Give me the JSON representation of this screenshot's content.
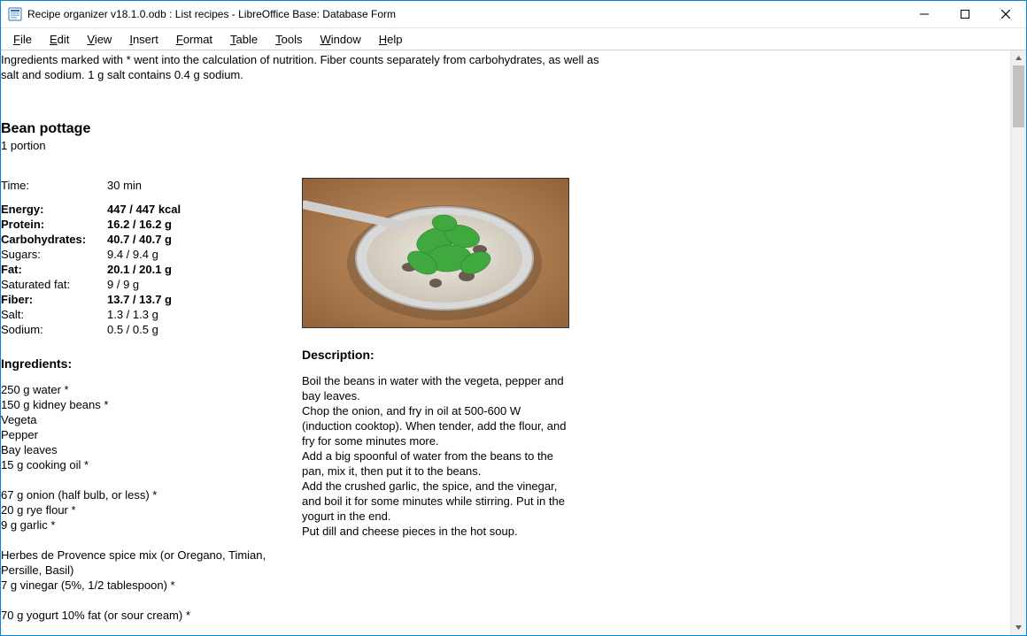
{
  "window": {
    "title": "Recipe organizer v18.1.0.odb : List recipes - LibreOffice Base: Database Form"
  },
  "menu": {
    "file": "File",
    "edit": "Edit",
    "view": "View",
    "insert": "Insert",
    "format": "Format",
    "table": "Table",
    "tools": "Tools",
    "window": "Window",
    "help": "Help"
  },
  "note_line1": "Ingredients marked with * went into the calculation of nutrition. Fiber counts separately from carbohydrates, as well as",
  "note_line2": "salt and sodium. 1 g salt contains 0.4 g sodium.",
  "recipe": {
    "title": "Bean pottage",
    "portion": "1 portion",
    "time_label": "Time:",
    "time_value": "30 min",
    "nutrition": [
      {
        "label": "Energy:",
        "value": "447 / 447 kcal",
        "bold": true
      },
      {
        "label": "Protein:",
        "value": "16.2 / 16.2 g",
        "bold": true
      },
      {
        "label": "Carbohydrates:",
        "value": "40.7 / 40.7 g",
        "bold": true
      },
      {
        "label": "Sugars:",
        "value": "9.4 / 9.4 g",
        "bold": false
      },
      {
        "label": "Fat:",
        "value": "20.1 / 20.1 g",
        "bold": true
      },
      {
        "label": "Saturated fat:",
        "value": "9 / 9 g",
        "bold": false
      },
      {
        "label": "Fiber:",
        "value": "13.7 / 13.7 g",
        "bold": true
      },
      {
        "label": "Salt:",
        "value": "1.3 / 1.3 g",
        "bold": false
      },
      {
        "label": "Sodium:",
        "value": "0.5 / 0.5 g",
        "bold": false
      }
    ],
    "ingredients_heading": "Ingredients:",
    "ingredients": "250 g water *\n150 g kidney beans *\nVegeta\nPepper\nBay leaves\n15 g cooking oil *\n\n67 g onion (half bulb, or less) *\n20 g rye flour *\n9 g garlic *\n\nHerbes de Provence spice mix (or Oregano, Timian, Persille, Basil)\n7 g vinegar (5%, 1/2 tablespoon) *\n\n70 g yogurt 10% fat (or sour cream) *",
    "description_heading": "Description:",
    "description": "Boil the beans in water with the vegeta, pepper and bay leaves.\nChop the onion, and fry in oil at 500-600 W (induction cooktop). When tender, add the flour, and fry for some minutes more.\nAdd a big spoonful of water from the beans to the pan, mix it, then put it to the beans.\nAdd the crushed garlic, the spice, and the vinegar, and boil it for some minutes while stirring. Put in the yogurt in the end.\nPut dill and cheese pieces in the hot soup."
  }
}
